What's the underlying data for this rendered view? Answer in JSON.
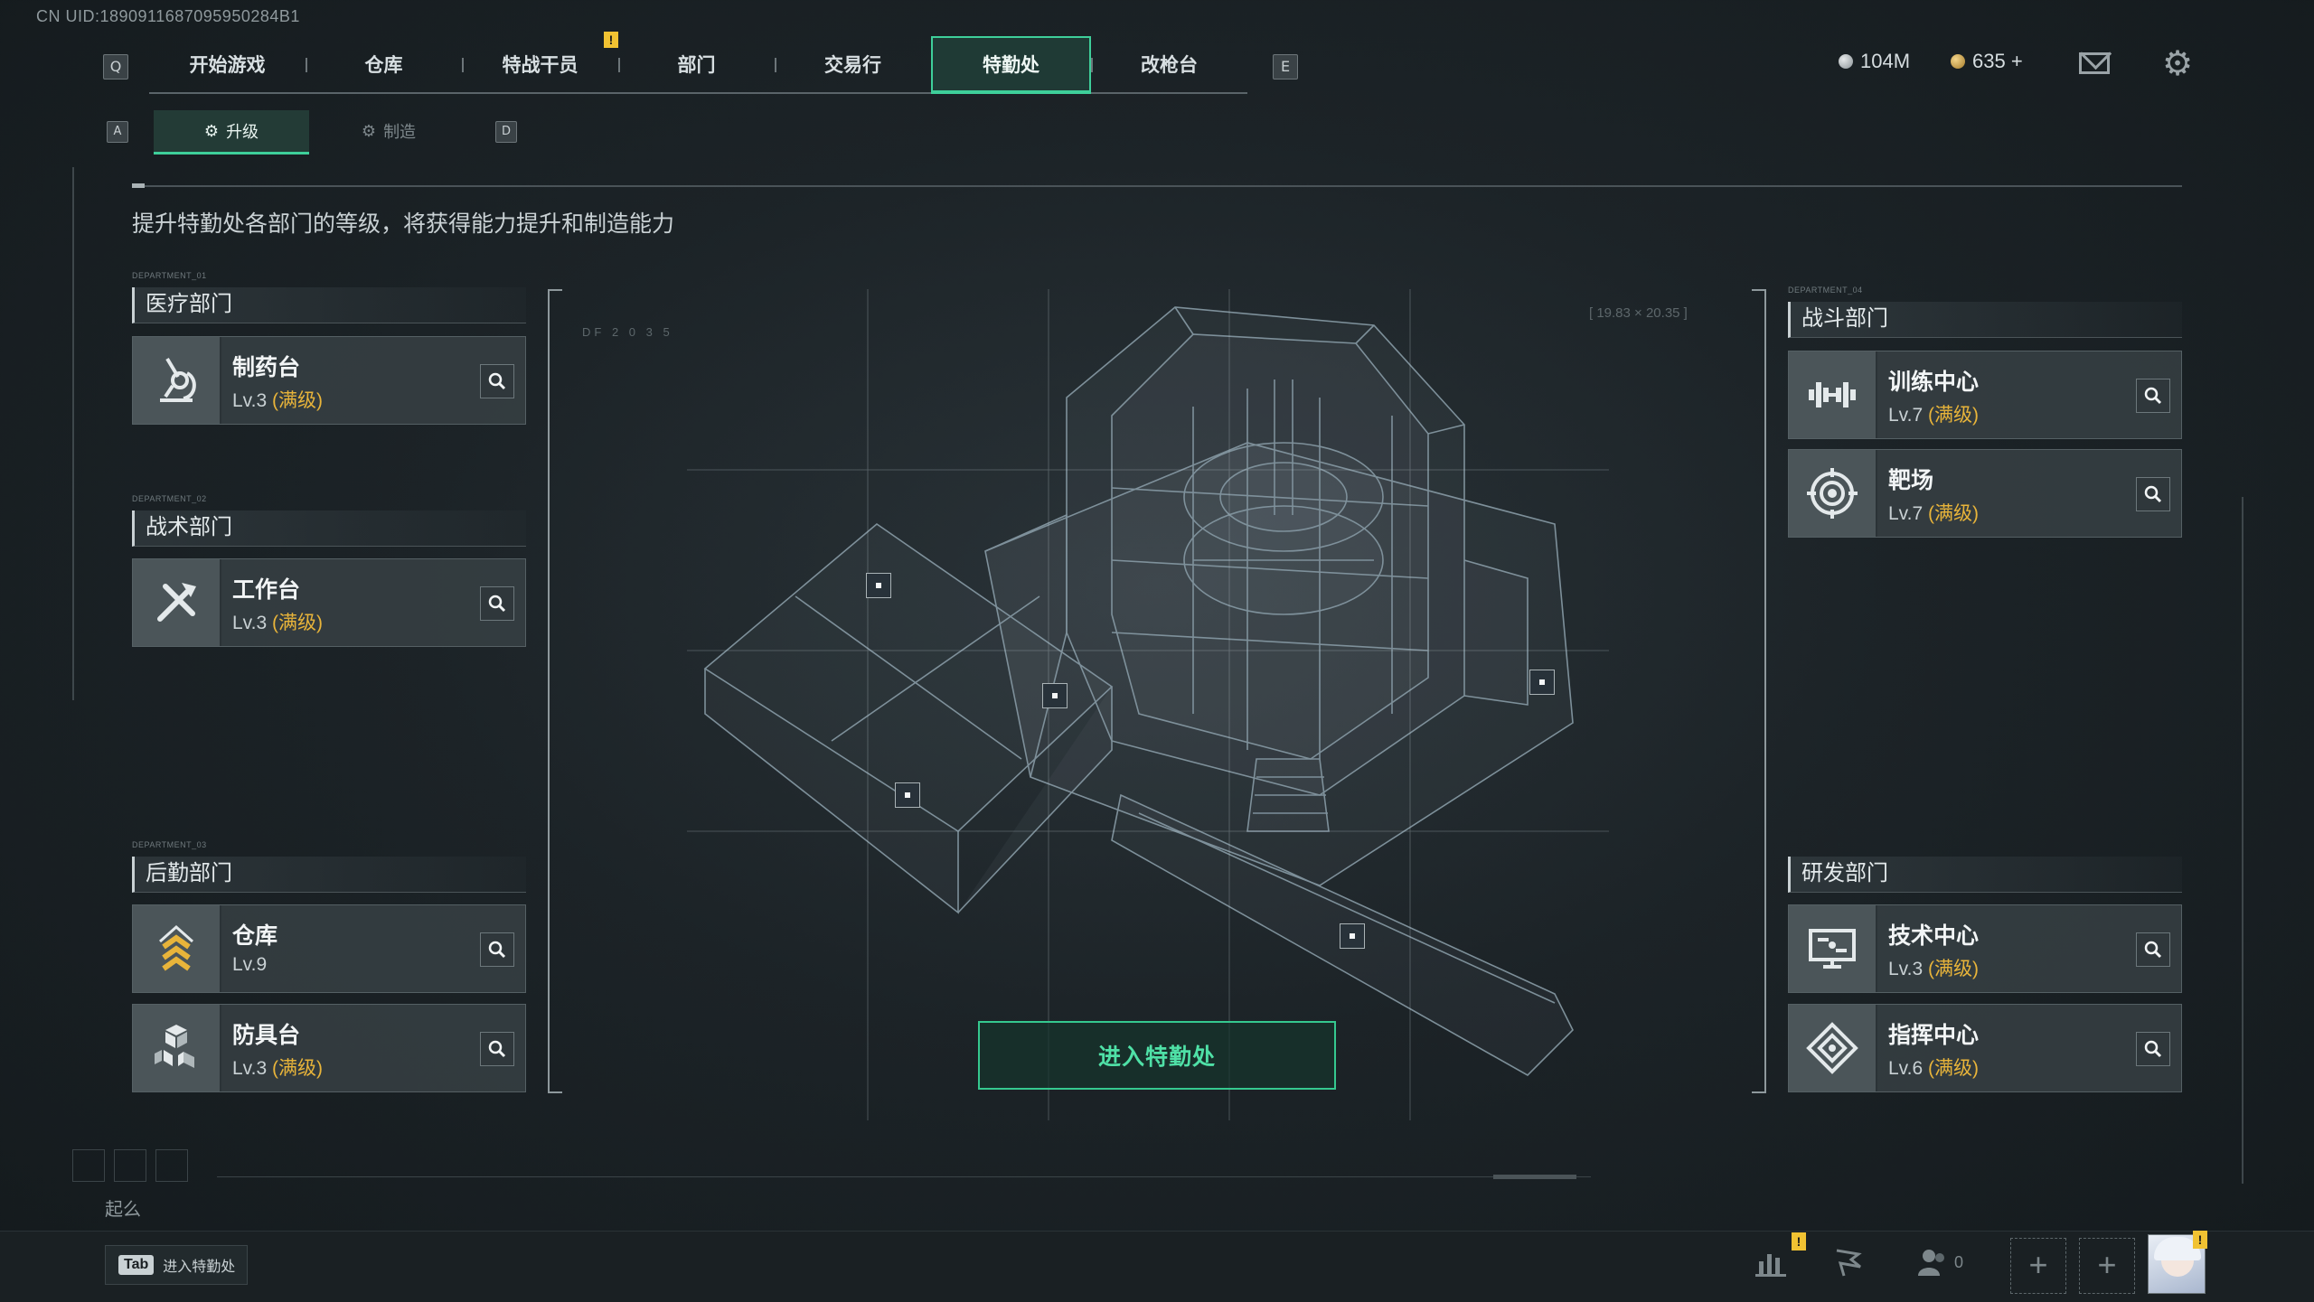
{
  "uid": "CN UID:1890911687095950284B1",
  "nav": {
    "left_key": "Q",
    "right_key": "E",
    "tabs": [
      "开始游戏",
      "仓库",
      "特战干员",
      "部门",
      "交易行",
      "特勤处",
      "改枪台"
    ],
    "active_tab": "特勤处",
    "alert_mark": "!"
  },
  "currency": {
    "primary_value": "104M",
    "secondary_value": "635 +"
  },
  "subtabs": {
    "left_key": "A",
    "right_key": "D",
    "upgrade": "升级",
    "craft": "制造"
  },
  "description": "提升特勤处各部门的等级，将获得能力提升和制造能力",
  "departments": {
    "medical": {
      "code": "DEPARTMENT_01",
      "title": "医疗部门",
      "items": [
        {
          "name": "制药台",
          "level": "Lv.3",
          "max": "(满级)"
        }
      ]
    },
    "tactical": {
      "code": "DEPARTMENT_02",
      "title": "战术部门",
      "items": [
        {
          "name": "工作台",
          "level": "Lv.3",
          "max": "(满级)"
        }
      ]
    },
    "logistics": {
      "code": "DEPARTMENT_03",
      "title": "后勤部门",
      "items": [
        {
          "name": "仓库",
          "level": "Lv.9",
          "max": ""
        },
        {
          "name": "防具台",
          "level": "Lv.3",
          "max": "(满级)"
        }
      ]
    },
    "combat": {
      "code": "DEPARTMENT_04",
      "title": "战斗部门",
      "items": [
        {
          "name": "训练中心",
          "level": "Lv.7",
          "max": "(满级)"
        },
        {
          "name": "靶场",
          "level": "Lv.7",
          "max": "(满级)"
        }
      ]
    },
    "research": {
      "title": "研发部门",
      "items": [
        {
          "name": "技术中心",
          "level": "Lv.3",
          "max": "(满级)"
        },
        {
          "name": "指挥中心",
          "level": "Lv.6",
          "max": "(满级)"
        }
      ]
    }
  },
  "enter_button": "进入特勤处",
  "schematic_text": {
    "code": "DF 2 0 3 5",
    "coords": "[ 19.83 × 20.35 ]"
  },
  "bottom": {
    "caption": "起么",
    "tab_key": "Tab",
    "tab_label": "进入特勤处",
    "friends_count": "0"
  },
  "colors": {
    "accent": "#3ecf9a",
    "max_level": "#e8b43a",
    "alert": "#f1c232"
  }
}
